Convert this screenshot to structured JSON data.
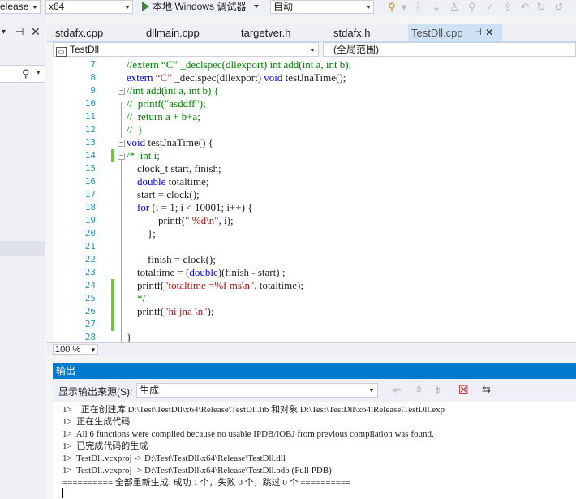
{
  "toolbar": {
    "config": "elease",
    "platform": "x64",
    "run_label": "本地 Windows 调试器",
    "mode": "自动"
  },
  "left_pane": {
    "pin_icon": "pin-icon",
    "close_icon": "close-icon",
    "search_icon": "search-icon"
  },
  "tabs": [
    {
      "label": "stdafx.cpp"
    },
    {
      "label": "dllmain.cpp"
    },
    {
      "label": "targetver.h"
    },
    {
      "label": "stdafx.h"
    },
    {
      "label": "TestDll.cpp",
      "active": true
    }
  ],
  "navbar": {
    "project": "TestDll",
    "scope": "(全局范围)"
  },
  "code_lines": [
    {
      "n": "7",
      "text": "//extern “C” _declspec(dllexport) int add(int a, int b);"
    },
    {
      "n": "8",
      "text": "extern “C” _declspec(dllexport) void testJnaTime();"
    },
    {
      "n": "9",
      "text": "//int add(int a, int b) {"
    },
    {
      "n": "10",
      "text": "//  printf(\"asddff\");"
    },
    {
      "n": "11",
      "text": "//  return a + b+a;"
    },
    {
      "n": "12",
      "text": "//  }"
    },
    {
      "n": "13",
      "text": "void testJnaTime() {"
    },
    {
      "n": "14",
      "text": "/*  int i;"
    },
    {
      "n": "15",
      "text": "    clock_t start, finish;"
    },
    {
      "n": "16",
      "text": "    double totaltime;"
    },
    {
      "n": "17",
      "text": "    start = clock();"
    },
    {
      "n": "18",
      "text": "    for (i = 1; i < 10001; i++) {"
    },
    {
      "n": "19",
      "text": "            printf(\" %d\\n\", i);"
    },
    {
      "n": "20",
      "text": "        };"
    },
    {
      "n": "21",
      "text": ""
    },
    {
      "n": "22",
      "text": "        finish = clock();"
    },
    {
      "n": "23",
      "text": "    totaltime = (double)(finish - start) ;"
    },
    {
      "n": "24",
      "text": "    printf(\"totaltime =%f ms\\n\", totaltime);"
    },
    {
      "n": "25",
      "text": "    */"
    },
    {
      "n": "26",
      "text": "    printf(\"hi jna \\n\");"
    },
    {
      "n": "27",
      "text": ""
    },
    {
      "n": "28",
      "text": "}"
    }
  ],
  "zoom": "100 %",
  "output": {
    "title": "输出",
    "source_label": "显示输出来源(S):",
    "source_value": "生成",
    "lines": [
      "1>    正在创建库 D:\\Test\\TestDll\\x64\\Release\\TestDll.lib 和对象 D:\\Test\\TestDll\\x64\\Release\\TestDll.exp",
      "1>  正在生成代码",
      "1>  All 6 functions were compiled because no usable IPDB/IOBJ from previous compilation was found.",
      "1>  已完成代码的生成",
      "1>  TestDll.vcxproj -> D:\\Test\\TestDll\\x64\\Release\\TestDll.dll",
      "1>  TestDll.vcxproj -> D:\\Test\\TestDll\\x64\\Release\\TestDll.pdb (Full PDB)",
      "========== 全部重新生成: 成功 1 个，失败 0 个，跳过 0 个 =========="
    ]
  },
  "colors": {
    "keyword": "#0000ff",
    "comment": "#008000",
    "string": "#a31515",
    "line_number": "#2b91af",
    "change_bar": "#6cc644",
    "output_header": "#007acc"
  }
}
